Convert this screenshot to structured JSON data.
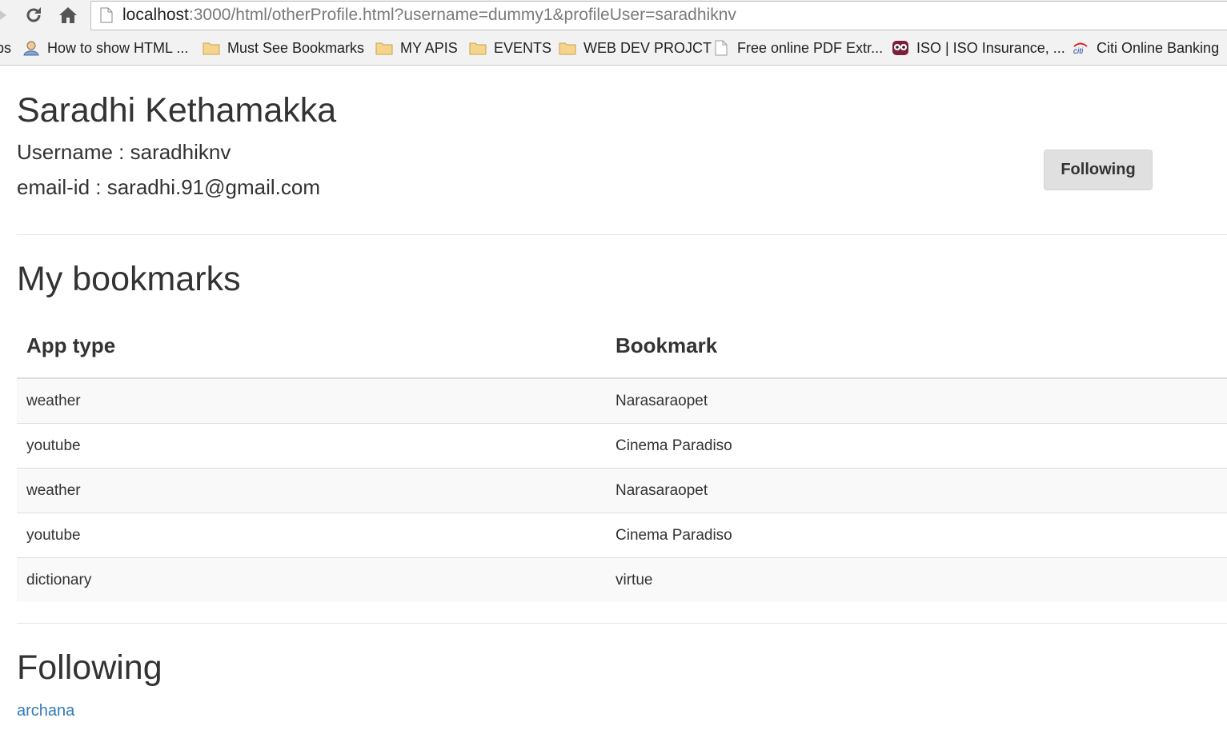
{
  "browser": {
    "url_host": "localhost",
    "url_rest": ":3000/html/otherProfile.html?username=dummy1&profileUser=saradhiknv",
    "bookmarks_clip": "ps",
    "bookmarks": [
      {
        "label": "How to show HTML ...",
        "icon": "user-icon"
      },
      {
        "label": "Must See Bookmarks",
        "icon": "folder-icon"
      },
      {
        "label": "MY APIS",
        "icon": "folder-icon"
      },
      {
        "label": "EVENTS",
        "icon": "folder-icon"
      },
      {
        "label": "WEB DEV PROJCT",
        "icon": "folder-icon"
      },
      {
        "label": "Free online PDF Extr...",
        "icon": "page-icon"
      },
      {
        "label": "ISO | ISO Insurance, ...",
        "icon": "owl-icon"
      },
      {
        "label": "Citi Online Banking",
        "icon": "citi-icon"
      }
    ]
  },
  "profile": {
    "name": "Saradhi Kethamakka",
    "username_line": "Username : saradhiknv",
    "email_line": "email-id : saradhi.91@gmail.com",
    "follow_button": "Following"
  },
  "bookmarks_section": {
    "title": "My bookmarks",
    "columns": [
      "App type",
      "Bookmark"
    ],
    "rows": [
      [
        "weather",
        "Narasaraopet"
      ],
      [
        "youtube",
        "Cinema Paradiso"
      ],
      [
        "weather",
        "Narasaraopet"
      ],
      [
        "youtube",
        "Cinema Paradiso"
      ],
      [
        "dictionary",
        "virtue"
      ]
    ]
  },
  "following_section": {
    "title": "Following",
    "users": [
      "archana"
    ]
  },
  "colors": {
    "link": "#337ab7",
    "button_bg": "#e0e0e0",
    "text": "#333333",
    "stripe": "#f9f9f9"
  }
}
